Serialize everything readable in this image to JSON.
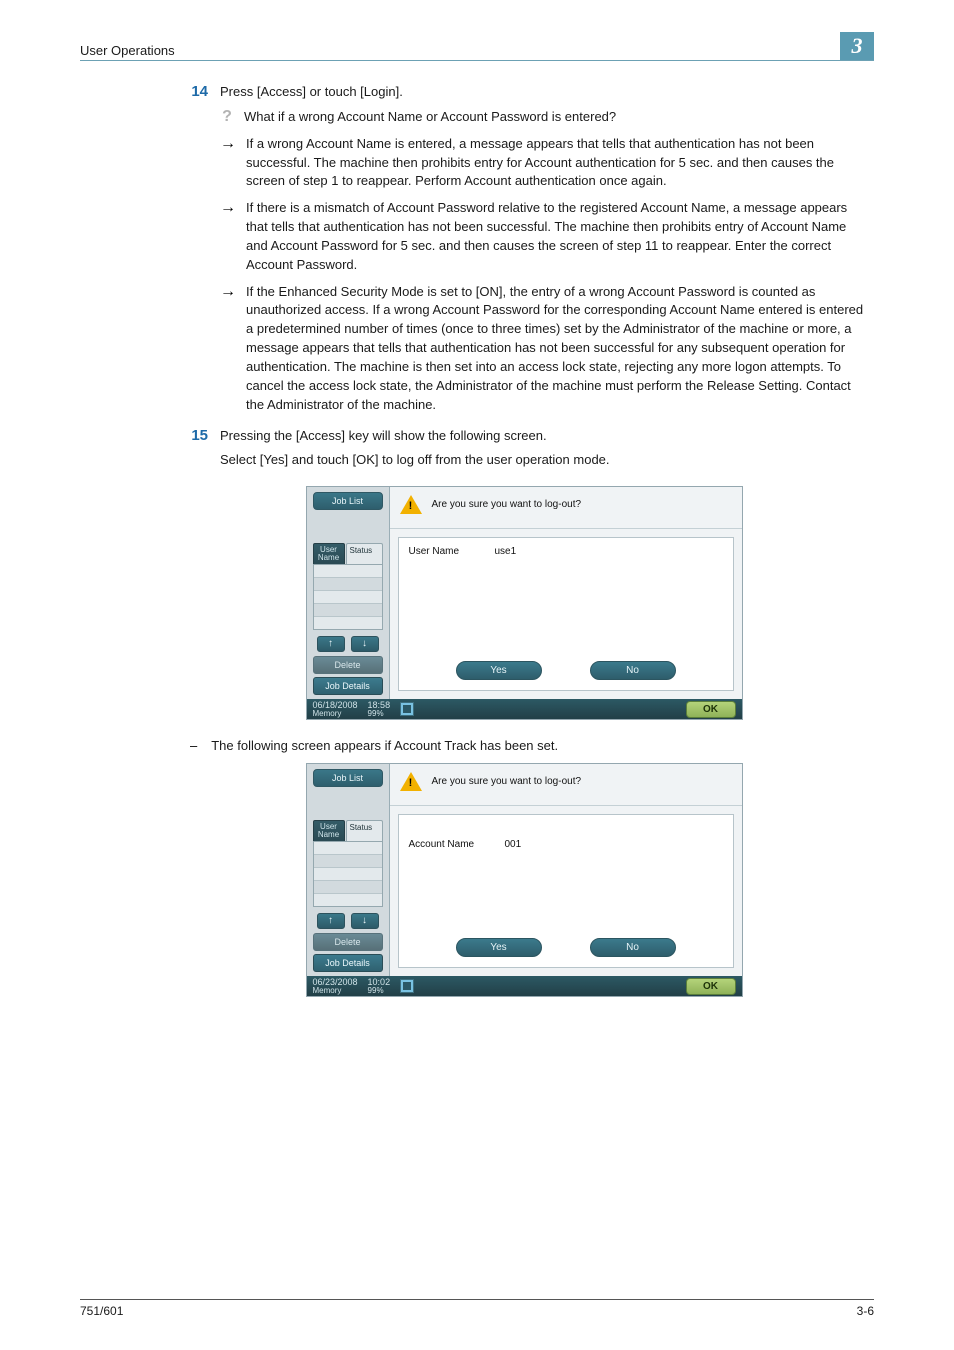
{
  "header": {
    "section": "User Operations",
    "chapter": "3"
  },
  "step14": {
    "num": "14",
    "lead": "Press [Access] or touch [Login].",
    "question": "What if a wrong Account Name or Account Password is entered?",
    "arrow1": "If a wrong Account Name is entered, a message appears that tells that authentication has not been successful. The machine then prohibits entry for Account authentication for 5 sec. and then causes the screen of step 1 to reappear. Perform Account authentication once again.",
    "arrow2": "If there is a mismatch of Account Password relative to the registered Account Name, a message appears that tells that authentication has not been successful. The machine then prohibits entry of Account Name and Account Password for 5 sec. and then causes the screen of step 11 to reappear. Enter the correct Account Password.",
    "arrow3": "If the Enhanced Security Mode is set to [ON], the entry of a wrong Account Password is counted as unauthorized access. If a wrong Account Password for the corresponding Account Name entered is entered a predetermined number of times (once to three times) set by the Administrator of the machine or more, a message appears that tells that authentication has not been successful for any subsequent operation for authentication. The machine is then set into an access lock state, rejecting any more logon attempts. To cancel the access lock state, the Administrator of the machine must perform the Release Setting. Contact the Administrator of the machine."
  },
  "step15": {
    "num": "15",
    "line1": "Pressing the [Access] key will show the following screen.",
    "line2": "Select [Yes] and touch [OK] to log off from the user operation mode.",
    "dash": "The following screen appears if Account Track has been set."
  },
  "shot_common": {
    "job_list": "Job List",
    "tab_user": "User\nName",
    "tab_status": "Status",
    "delete": "Delete",
    "job_details": "Job Details",
    "prompt": "Are you sure you want to log-out?",
    "yes": "Yes",
    "no": "No",
    "ok": "OK",
    "memory": "Memory",
    "mem_pct": "99%"
  },
  "shot1": {
    "field_label": "User Name",
    "field_value": "use1",
    "date": "06/18/2008",
    "time": "18:58"
  },
  "shot2": {
    "field_label": "Account Name",
    "field_value": "001",
    "date": "06/23/2008",
    "time": "10:02"
  },
  "footer": {
    "left": "751/601",
    "right": "3-6"
  }
}
